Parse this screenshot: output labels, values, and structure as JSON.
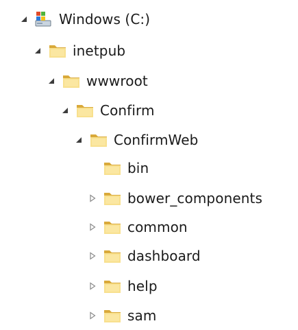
{
  "tree": {
    "drive": {
      "label": "Windows (C:)",
      "icon": "drive-icon",
      "state": "expanded"
    },
    "inetpub": {
      "label": "inetpub",
      "icon": "folder-icon",
      "state": "expanded"
    },
    "wwwroot": {
      "label": "wwwroot",
      "icon": "folder-icon",
      "state": "expanded"
    },
    "confirm": {
      "label": "Confirm",
      "icon": "folder-icon",
      "state": "expanded"
    },
    "confirmweb": {
      "label": "ConfirmWeb",
      "icon": "folder-icon",
      "state": "expanded"
    },
    "bin": {
      "label": "bin",
      "icon": "folder-icon",
      "state": "leaf"
    },
    "bower_components": {
      "label": "bower_components",
      "icon": "folder-icon",
      "state": "collapsed"
    },
    "common": {
      "label": "common",
      "icon": "folder-icon",
      "state": "collapsed"
    },
    "dashboard": {
      "label": "dashboard",
      "icon": "folder-icon",
      "state": "collapsed"
    },
    "help": {
      "label": "help",
      "icon": "folder-icon",
      "state": "collapsed"
    },
    "sam": {
      "label": "sam",
      "icon": "folder-icon",
      "state": "collapsed"
    }
  },
  "colors": {
    "expanded_arrow": "#3c3c3c",
    "collapsed_arrow": "#8a8a8a",
    "folder_light": "#f8e08e",
    "folder_dark": "#d9a93a"
  }
}
